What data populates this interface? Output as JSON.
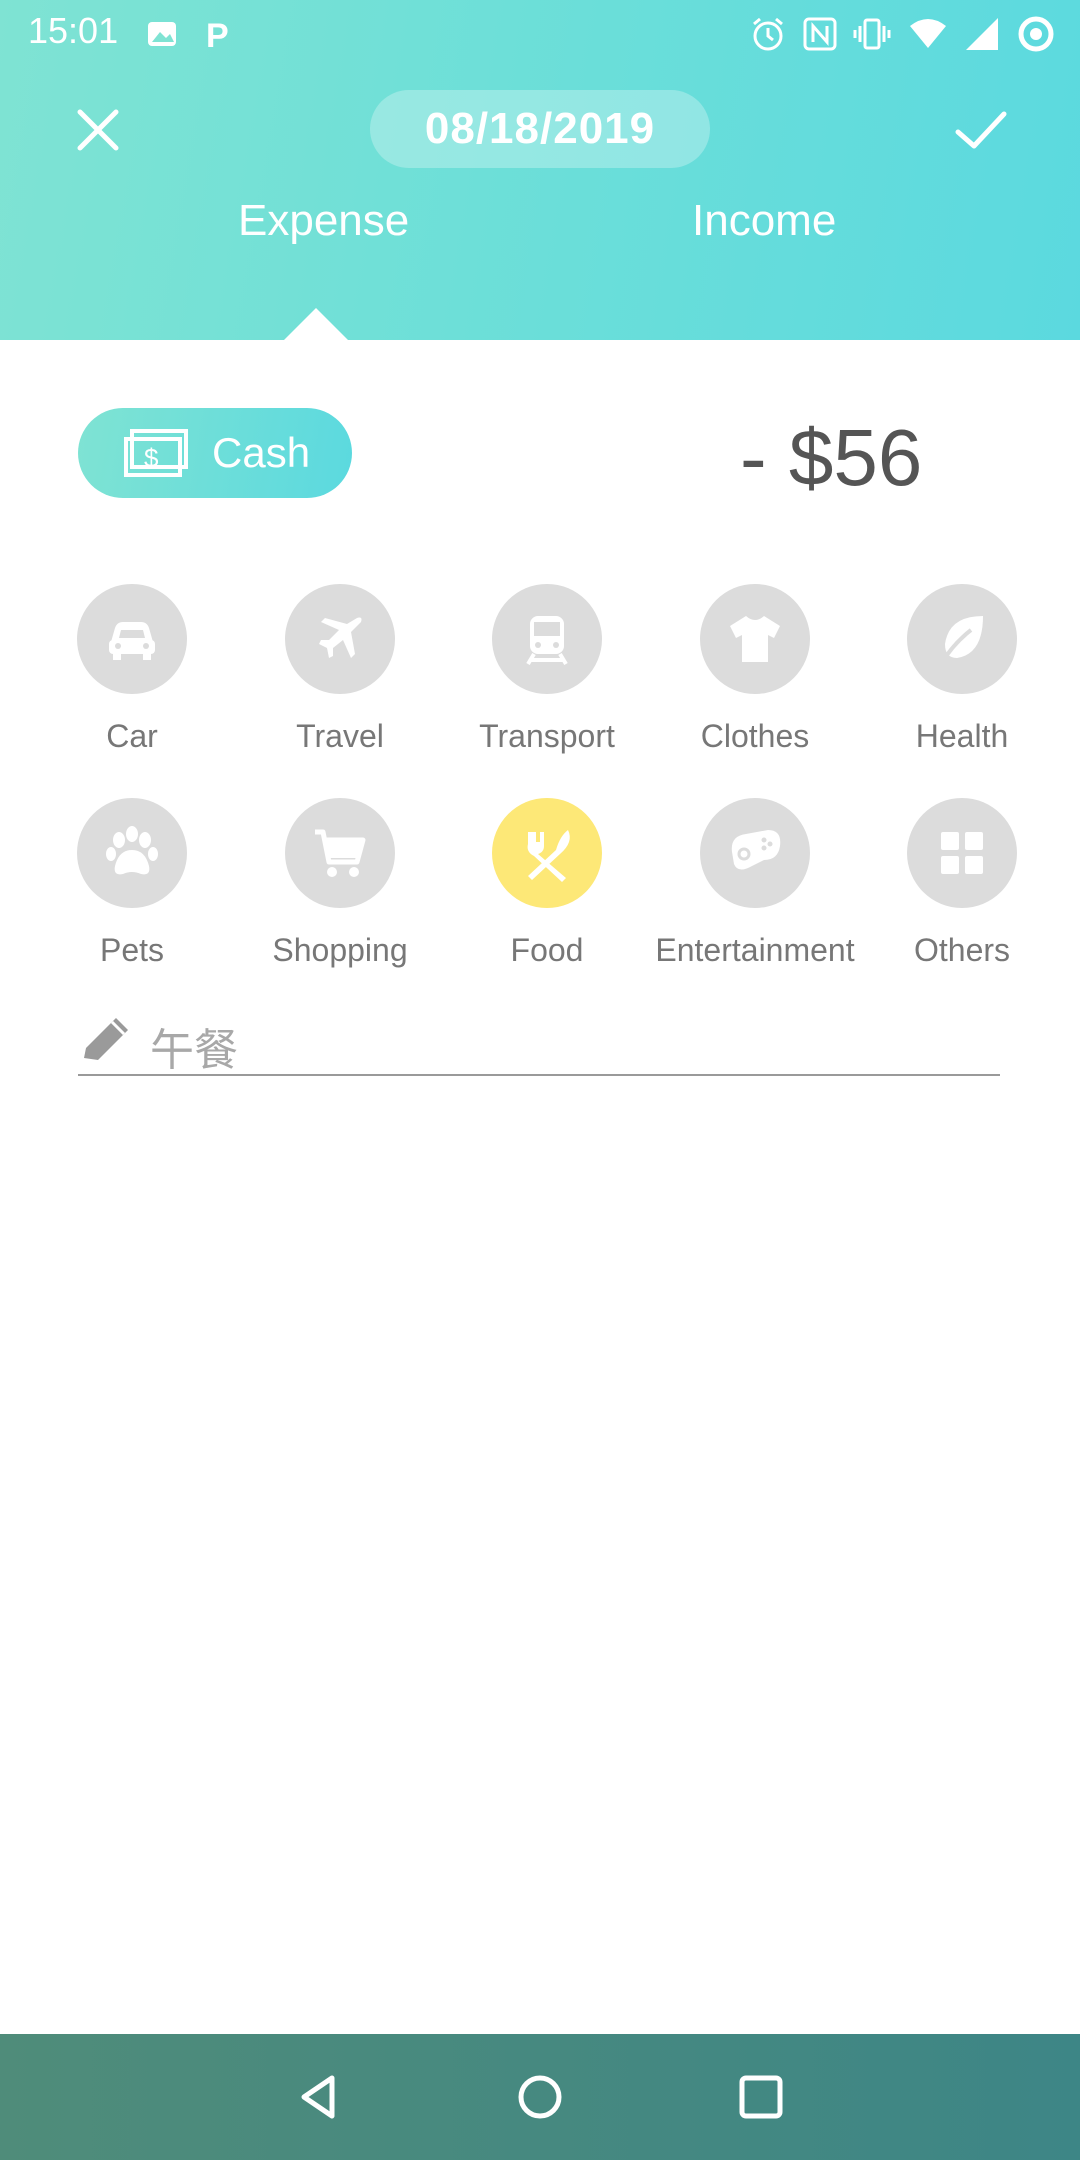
{
  "status_bar": {
    "time": "15:01"
  },
  "header": {
    "date": "08/18/2019",
    "tabs": [
      {
        "label": "Expense",
        "selected": true
      },
      {
        "label": "Income",
        "selected": false
      }
    ]
  },
  "account": {
    "label": "Cash",
    "icon": "cash-icon"
  },
  "amount": "- $56",
  "categories": [
    {
      "label": "Car",
      "icon": "car-icon",
      "selected": false
    },
    {
      "label": "Travel",
      "icon": "airplane-icon",
      "selected": false
    },
    {
      "label": "Transport",
      "icon": "train-icon",
      "selected": false
    },
    {
      "label": "Clothes",
      "icon": "shirt-icon",
      "selected": false
    },
    {
      "label": "Health",
      "icon": "leaf-icon",
      "selected": false
    },
    {
      "label": "Pets",
      "icon": "paw-icon",
      "selected": false
    },
    {
      "label": "Shopping",
      "icon": "cart-icon",
      "selected": false
    },
    {
      "label": "Food",
      "icon": "fork-knife-icon",
      "selected": true
    },
    {
      "label": "Entertainment",
      "icon": "gamepad-icon",
      "selected": false
    },
    {
      "label": "Others",
      "icon": "grid-icon",
      "selected": false
    }
  ],
  "note": {
    "value": "午餐"
  },
  "colors": {
    "accent": "#5bd9df",
    "selected_category": "#fde877",
    "category_bg": "#dcdcdc"
  }
}
